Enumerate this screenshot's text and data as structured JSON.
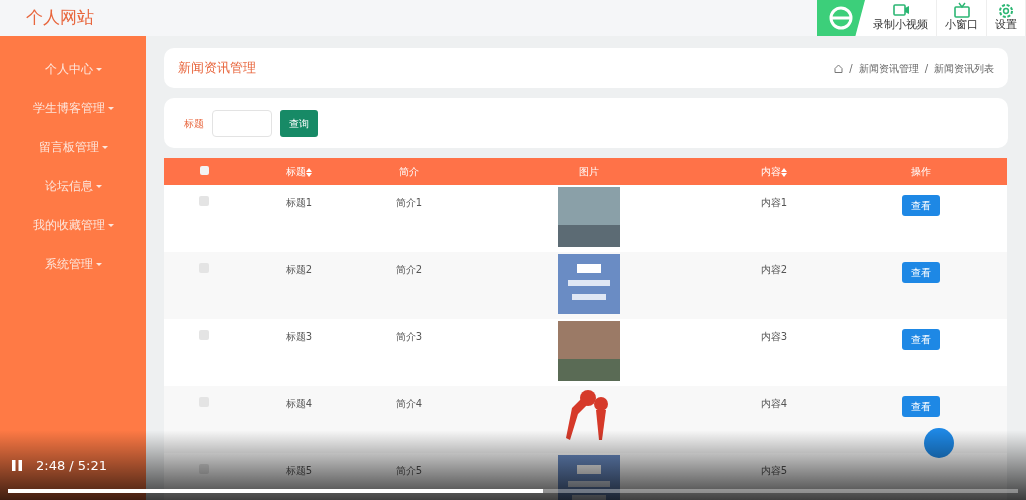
{
  "site_title": "个人网站",
  "toolbar": [
    {
      "kind": "record",
      "label": "录制小视频"
    },
    {
      "kind": "window",
      "label": "小窗口"
    },
    {
      "kind": "settings",
      "label": "设置"
    }
  ],
  "sidebar": {
    "items": [
      {
        "label": "个人中心"
      },
      {
        "label": "学生博客管理"
      },
      {
        "label": "留言板管理"
      },
      {
        "label": "论坛信息"
      },
      {
        "label": "我的收藏管理"
      },
      {
        "label": "系统管理"
      }
    ]
  },
  "page_header": {
    "title": "新闻资讯管理",
    "separator": "/",
    "breadcrumb": [
      "新闻资讯管理",
      "新闻资讯列表"
    ]
  },
  "search": {
    "label": "标题",
    "button": "查询"
  },
  "table": {
    "columns": [
      {
        "kind": "check",
        "checked": false
      },
      {
        "kind": "text",
        "label": "标题",
        "sortable": true
      },
      {
        "kind": "text",
        "label": "简介",
        "sortable": false
      },
      {
        "kind": "text",
        "label": "图片",
        "sortable": false
      },
      {
        "kind": "text",
        "label": "内容",
        "sortable": true
      },
      {
        "kind": "text",
        "label": "操作",
        "sortable": false
      }
    ],
    "rows": [
      {
        "kind": "building",
        "checked": false,
        "title": "标题1",
        "summary": "简介1",
        "content": "内容1",
        "action": "查看"
      },
      {
        "kind": "logo",
        "checked": false,
        "title": "标题2",
        "summary": "简介2",
        "content": "内容2",
        "action": "查看"
      },
      {
        "kind": "campus",
        "checked": false,
        "title": "标题3",
        "summary": "简介3",
        "content": "内容3",
        "action": "查看"
      },
      {
        "kind": "microphones",
        "checked": false,
        "title": "标题4",
        "summary": "简介4",
        "content": "内容4",
        "action": "查看"
      },
      {
        "kind": "logo",
        "checked": false,
        "title": "标题5",
        "summary": "简介5",
        "content": "内容5"
      }
    ]
  },
  "video_controls": {
    "playing": true,
    "time": "2:48 / 5:21",
    "level": 0.53
  }
}
